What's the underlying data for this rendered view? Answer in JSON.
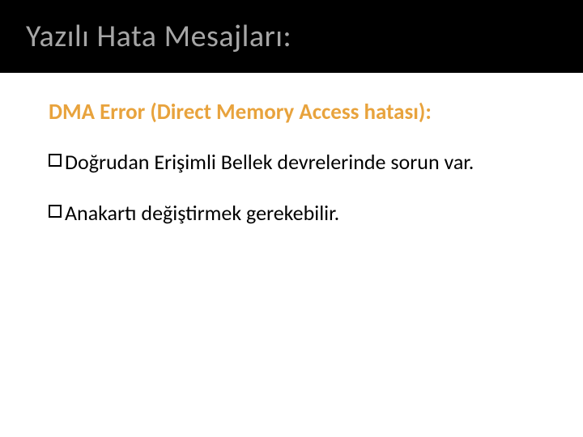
{
  "title": "Yazılı Hata Mesajları:",
  "heading": "DMA Error (Direct Memory Access hatası):",
  "bullets": [
    "Doğrudan Erişimli Bellek devrelerinde sorun var.",
    " Anakartı değiştirmek gerekebilir."
  ]
}
